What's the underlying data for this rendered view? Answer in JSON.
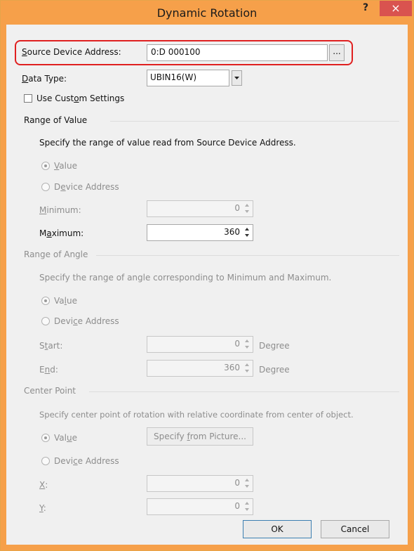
{
  "window": {
    "title": "Dynamic Rotation",
    "help": "?",
    "close": "×"
  },
  "source": {
    "label": "Source Device Address:",
    "label_u": "S",
    "label_rest": "ource Device Address:",
    "value": "0:D 000100",
    "browse": "..."
  },
  "datatype": {
    "label_u": "D",
    "label_rest": "ata Type:",
    "value": "UBIN16(W)"
  },
  "custom": {
    "label_pre": "Use Cust",
    "label_u": "o",
    "label_post": "m Settings"
  },
  "range_value": {
    "heading": "Range of Value",
    "desc": "Specify the range of value read from Source Device Address.",
    "opt_value_u": "V",
    "opt_value_rest": "alue",
    "opt_device_pre": "D",
    "opt_device_u": "e",
    "opt_device_post": "vice Address",
    "min_u": "M",
    "min_rest": "inimum:",
    "min_value": "0",
    "max_pre": "M",
    "max_u": "a",
    "max_post": "ximum:",
    "max_value": "360"
  },
  "range_angle": {
    "heading": "Range of Angle",
    "desc": "Specify the range of angle corresponding to Minimum and Maximum.",
    "opt_value_pre": "Va",
    "opt_value_u": "l",
    "opt_value_post": "ue",
    "opt_device_pre": "Devi",
    "opt_device_u": "c",
    "opt_device_post": "e Address",
    "start_pre": "S",
    "start_u": "t",
    "start_post": "art:",
    "start_value": "0",
    "end_pre": "E",
    "end_u": "n",
    "end_post": "d:",
    "end_value": "360",
    "unit": "Degree"
  },
  "center": {
    "heading": "Center Point",
    "desc": "Specify center point of rotation with relative coordinate from center of object.",
    "opt_value_pre": "Val",
    "opt_value_u": "u",
    "opt_value_post": "e",
    "picture_pre": "Specify ",
    "picture_u": "f",
    "picture_post": "rom Picture...",
    "opt_device_pre": "Devi",
    "opt_device_u": "c",
    "opt_device_post": "e Address",
    "x_u": "X",
    "x_rest": ":",
    "x_value": "0",
    "y_u": "Y",
    "y_rest": ":",
    "y_value": "0"
  },
  "buttons": {
    "ok": "OK",
    "cancel": "Cancel"
  }
}
